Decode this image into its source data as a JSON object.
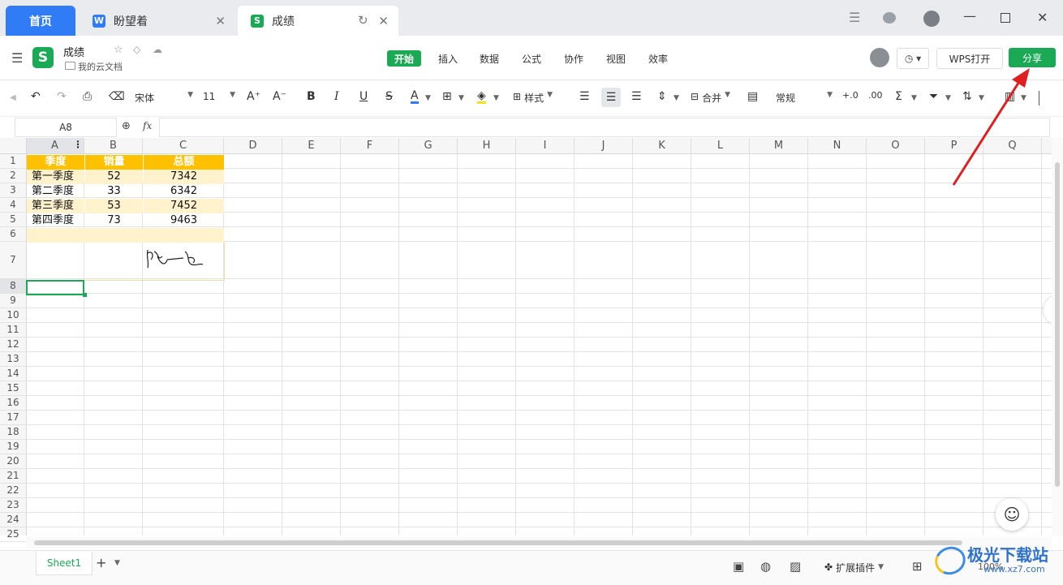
{
  "tabs": {
    "home": "首页",
    "doc1": {
      "badge": "W",
      "title": "盼望着",
      "color": "#2f7cf6"
    },
    "doc2": {
      "badge": "S",
      "title": "成绩",
      "color": "#1aaa55"
    }
  },
  "header": {
    "app_badge": "S",
    "doc_title": "成绩",
    "location": "我的云文档",
    "menus": [
      "开始",
      "插入",
      "数据",
      "公式",
      "协作",
      "视图",
      "效率"
    ],
    "active_menu": "开始",
    "open_wps_label": "WPS打开",
    "share_label": "分享",
    "accent": "#1aaa55"
  },
  "toolbar": {
    "font_name": "宋体",
    "font_size": "11",
    "style_label": "样式",
    "merge_label": "合并",
    "number_format": "常规",
    "bold": "B",
    "italic": "I",
    "underline": "U",
    "strike": "S",
    "font_color": "A",
    "grow": "A⁺",
    "shrink": "A⁻"
  },
  "formula": {
    "name_box": "A8",
    "fx": "fx"
  },
  "grid": {
    "columns": [
      "A",
      "B",
      "C",
      "D",
      "E",
      "F",
      "G",
      "H",
      "I",
      "J",
      "K",
      "L",
      "M",
      "N",
      "O",
      "P",
      "Q"
    ],
    "rows": [
      "1",
      "2",
      "3",
      "4",
      "5",
      "6",
      "7",
      "8",
      "9",
      "10",
      "11",
      "12",
      "13",
      "14",
      "15",
      "16",
      "17",
      "18",
      "19",
      "20",
      "21",
      "22",
      "23",
      "24",
      "25"
    ],
    "table_header": [
      "季度",
      "销量",
      "总额"
    ],
    "table_rows": [
      [
        "第一季度",
        "52",
        "7342"
      ],
      [
        "第二季度",
        "33",
        "6342"
      ],
      [
        "第三季度",
        "53",
        "7452"
      ],
      [
        "第四季度",
        "73",
        "9463"
      ]
    ],
    "header_color": "#ffc000",
    "band_color": "#fff2cc"
  },
  "status": {
    "sheet_tab": "Sheet1",
    "add_sheet": "+",
    "plugins_label": "扩展插件",
    "zoom": "100%"
  },
  "watermark": "极光下载站",
  "watermark_url": "www.xz7.com"
}
